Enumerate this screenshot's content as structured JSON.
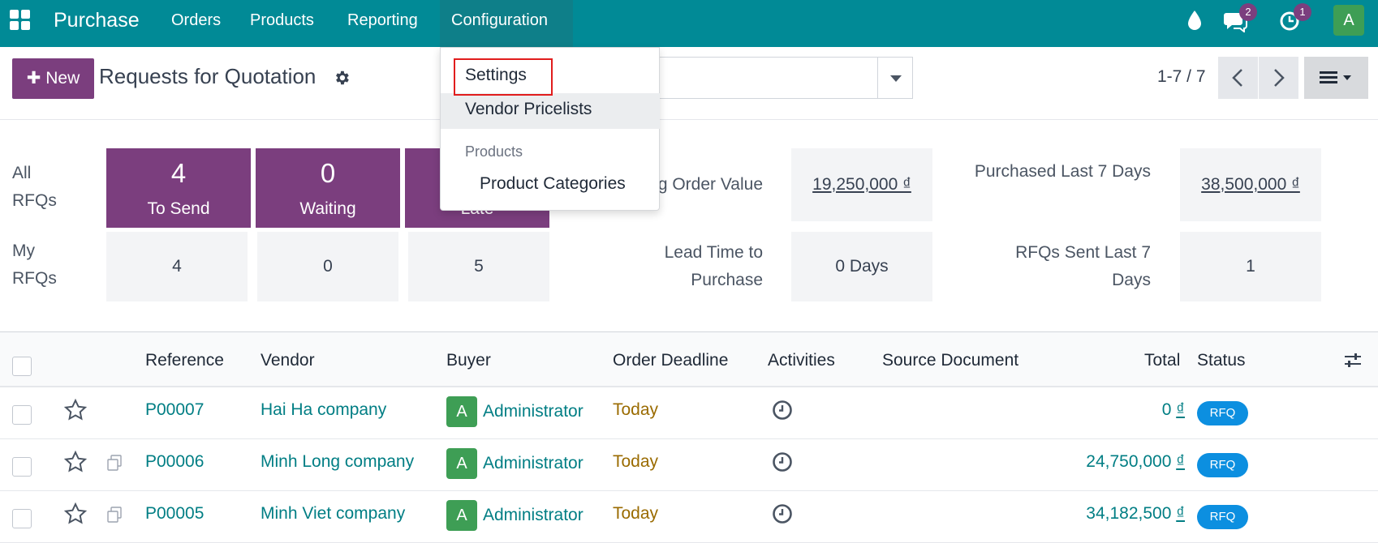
{
  "navbar": {
    "brand": "Purchase",
    "menus": [
      "Orders",
      "Products",
      "Reporting",
      "Configuration"
    ],
    "messages_count": "2",
    "activities_count": "1",
    "avatar_initial": "A",
    "color": "#018a96"
  },
  "config_menu": {
    "settings": "Settings",
    "vendor_pricelists": "Vendor Pricelists",
    "products_header": "Products",
    "product_categories": "Product Categories"
  },
  "control_panel": {
    "new_button": "New",
    "title": "Requests for Quotation",
    "pager": "1-7 / 7"
  },
  "dashboard": {
    "all_rfqs_label": "All RFQs",
    "my_rfqs_label": "My RFQs",
    "tiles": [
      {
        "value": "4",
        "label": "To Send"
      },
      {
        "value": "0",
        "label": "Waiting"
      },
      {
        "value": "",
        "label": "Late"
      }
    ],
    "my_values": [
      "4",
      "0",
      "5"
    ],
    "kpis": [
      {
        "label": "Avg Order Value",
        "value": "19,250,000 ₫"
      },
      {
        "label": "Purchased Last 7 Days",
        "value": "38,500,000 ₫"
      },
      {
        "label": "Lead Time to Purchase",
        "value": "0 Days"
      },
      {
        "label": "RFQs Sent Last 7 Days",
        "value": "1"
      }
    ],
    "accent": "#7b3e7e"
  },
  "table": {
    "columns": [
      "Reference",
      "Vendor",
      "Buyer",
      "Order Deadline",
      "Activities",
      "Source Document",
      "Total",
      "Status"
    ],
    "rows": [
      {
        "reference": "P00007",
        "vendor": "Hai Ha company",
        "buyer_initial": "A",
        "buyer": "Administrator",
        "deadline": "Today",
        "total_amount": "0",
        "currency": "₫",
        "status": "RFQ"
      },
      {
        "reference": "P00006",
        "vendor": "Minh Long company",
        "buyer_initial": "A",
        "buyer": "Administrator",
        "deadline": "Today",
        "total_amount": "24,750,000",
        "currency": "₫",
        "status": "RFQ"
      },
      {
        "reference": "P00005",
        "vendor": "Minh Viet company",
        "buyer_initial": "A",
        "buyer": "Administrator",
        "deadline": "Today",
        "total_amount": "34,182,500",
        "currency": "₫",
        "status": "RFQ"
      }
    ],
    "link_color": "#017e84",
    "deadline_color": "#9a6b01",
    "status_color": "#0c8fe0"
  }
}
